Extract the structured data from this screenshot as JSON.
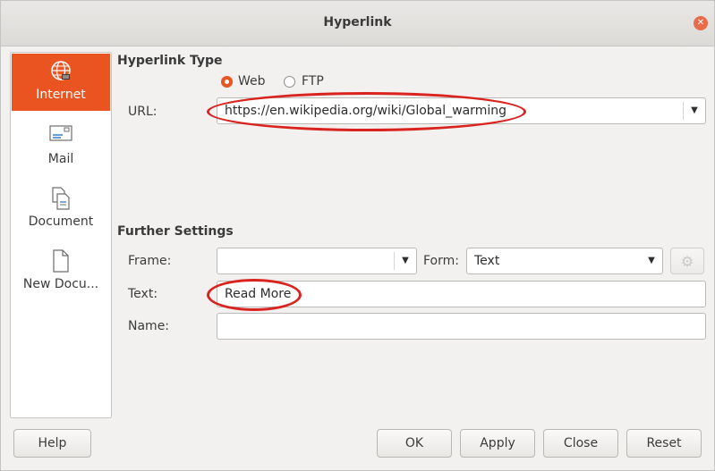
{
  "window": {
    "title": "Hyperlink"
  },
  "sidebar": {
    "items": [
      {
        "label": "Internet",
        "icon": "globe-icon"
      },
      {
        "label": "Mail",
        "icon": "envelope-icon"
      },
      {
        "label": "Document",
        "icon": "document-icon"
      },
      {
        "label": "New Docu...",
        "icon": "new-document-icon"
      }
    ]
  },
  "hyperlink_type": {
    "heading": "Hyperlink Type",
    "options": [
      {
        "label": "Web",
        "selected": true
      },
      {
        "label": "FTP",
        "selected": false
      }
    ],
    "url_label": "URL:",
    "url_value": "https://en.wikipedia.org/wiki/Global_warming"
  },
  "further_settings": {
    "heading": "Further Settings",
    "frame_label": "Frame:",
    "frame_value": "",
    "form_label": "Form:",
    "form_value": "Text",
    "text_label": "Text:",
    "text_value": "Read More",
    "name_label": "Name:",
    "name_value": ""
  },
  "buttons": {
    "help": "Help",
    "ok": "OK",
    "apply": "Apply",
    "close": "Close",
    "reset": "Reset"
  },
  "colors": {
    "accent": "#e95420",
    "annotation": "#d9231f"
  }
}
